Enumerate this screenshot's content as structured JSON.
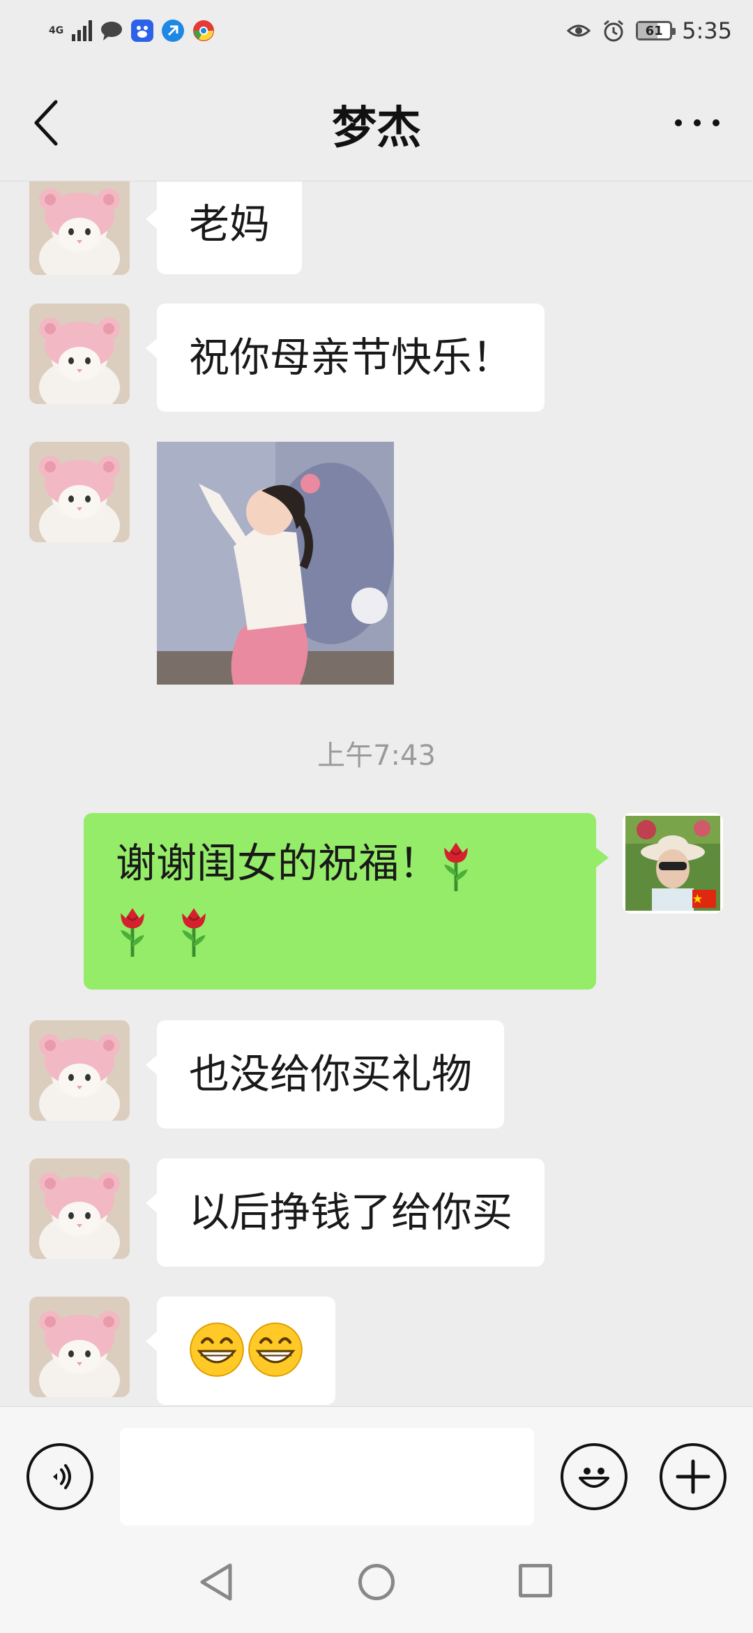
{
  "status_bar": {
    "network": "4G",
    "time": "5:35",
    "battery": "61",
    "battery_level": 0.61,
    "left_icons": [
      "signal-icon",
      "message-bubble-icon",
      "baidu-icon",
      "browser-icon",
      "chrome-icon"
    ],
    "right_icons": [
      "eye-icon",
      "alarm-icon",
      "battery-icon"
    ]
  },
  "header": {
    "title": "梦杰",
    "back_icon": "chevron-left-icon",
    "more_icon": "more-dots-icon"
  },
  "messages": [
    {
      "from": "contact",
      "type": "text",
      "text": "老妈"
    },
    {
      "from": "contact",
      "type": "text",
      "text": "祝你母亲节快乐！"
    },
    {
      "from": "contact",
      "type": "image"
    },
    {
      "type": "timestamp",
      "text": "上午7:43"
    },
    {
      "from": "me",
      "type": "text",
      "text": "谢谢闺女的祝福！🌹🌹🌹"
    },
    {
      "from": "contact",
      "type": "text",
      "text": "也没给你买礼物"
    },
    {
      "from": "contact",
      "type": "text",
      "text": "以后挣钱了给你买"
    },
    {
      "from": "contact",
      "type": "text",
      "text": "😁😁"
    }
  ],
  "input_bar": {
    "voice_icon": "voice-icon",
    "input_value": "",
    "emoji_icon": "emoji-face-icon",
    "plus_icon": "plus-icon"
  },
  "colors": {
    "background": "#ededed",
    "outgoing_bubble": "#95ec69",
    "incoming_bubble": "#ffffff",
    "timestamp": "#9a9a9a"
  },
  "system_nav": {
    "icons": [
      "nav-back-icon",
      "nav-home-icon",
      "nav-recent-icon"
    ]
  }
}
